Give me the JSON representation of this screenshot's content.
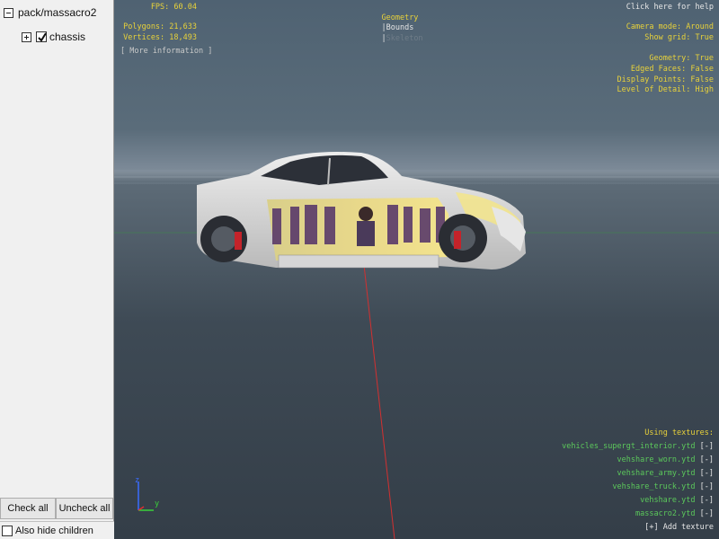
{
  "sidebar": {
    "tree": [
      {
        "label": "pack/massacro2",
        "toggle": "minus",
        "has_checkbox": false,
        "checked": false
      },
      {
        "label": "chassis",
        "toggle": "plus",
        "has_checkbox": true,
        "checked": true
      }
    ],
    "check_all_label": "Check all",
    "uncheck_all_label": "Uncheck all",
    "also_hide_label": "Also hide children",
    "also_hide_checked": false
  },
  "viewport": {
    "fps": "FPS: 60.04",
    "polygons": "Polygons: 21,633",
    "vertices": "Vertices: 18,493",
    "more_info": "[ More information ]",
    "tabs": {
      "geometry": "Geometry",
      "sep1": "|",
      "bounds": "Bounds",
      "sep2": "|",
      "skeleton": "Skeleton"
    },
    "help": "Click here for help",
    "camera_mode": "Camera mode: Around",
    "show_grid": "Show grid: True",
    "geometry": "Geometry: True",
    "edged_faces": "Edged Faces: False",
    "display_points": "Display Points: False",
    "lod": "Level of Detail: High",
    "using_textures": "Using textures:",
    "textures": [
      {
        "name": "vehicles_supergt_interior.ytd",
        "action": "[-]"
      },
      {
        "name": "vehshare_worn.ytd",
        "action": "[-]"
      },
      {
        "name": "vehshare_army.ytd",
        "action": "[-]"
      },
      {
        "name": "vehshare_truck.ytd",
        "action": "[-]"
      },
      {
        "name": "vehshare.ytd",
        "action": "[-]"
      },
      {
        "name": "massacro2.ytd",
        "action": "[-]"
      }
    ],
    "add_texture": "[+] Add texture",
    "axis": {
      "z": "z",
      "y": "y"
    },
    "colors": {
      "overlay_yellow": "#e8d23a",
      "texture_green": "#5bc85b",
      "axis_blue": "#3a6cff",
      "axis_green": "#3ad03a",
      "axis_red": "#e03030"
    }
  }
}
